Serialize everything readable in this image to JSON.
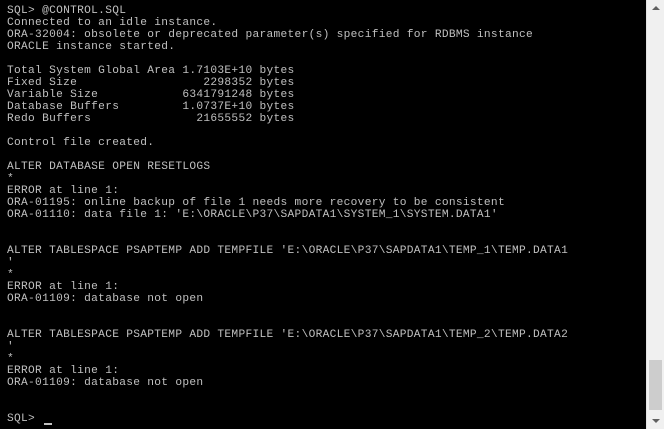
{
  "console": {
    "lines": [
      "SQL> @CONTROL.SQL",
      "Connected to an idle instance.",
      "ORA-32004: obsolete or deprecated parameter(s) specified for RDBMS instance",
      "ORACLE instance started.",
      "",
      "Total System Global Area 1.7103E+10 bytes",
      "Fixed Size                  2298352 bytes",
      "Variable Size            6341791248 bytes",
      "Database Buffers         1.0737E+10 bytes",
      "Redo Buffers               21655552 bytes",
      "",
      "Control file created.",
      "",
      "ALTER DATABASE OPEN RESETLOGS",
      "*",
      "ERROR at line 1:",
      "ORA-01195: online backup of file 1 needs more recovery to be consistent",
      "ORA-01110: data file 1: 'E:\\ORACLE\\P37\\SAPDATA1\\SYSTEM_1\\SYSTEM.DATA1'",
      "",
      "",
      "ALTER TABLESPACE PSAPTEMP ADD TEMPFILE 'E:\\ORACLE\\P37\\SAPDATA1\\TEMP_1\\TEMP.DATA1",
      "'",
      "*",
      "ERROR at line 1:",
      "ORA-01109: database not open",
      "",
      "",
      "ALTER TABLESPACE PSAPTEMP ADD TEMPFILE 'E:\\ORACLE\\P37\\SAPDATA1\\TEMP_2\\TEMP.DATA2",
      "'",
      "*",
      "ERROR at line 1:",
      "ORA-01109: database not open",
      "",
      "",
      "SQL> "
    ]
  },
  "colors": {
    "background": "#000000",
    "text": "#c0c0c0",
    "scrollbar": "#f0f0f0",
    "scrollbar_thumb": "#cdcdcd"
  },
  "icons": {
    "scroll_up": "chevron-up-icon",
    "scroll_down": "chevron-down-icon"
  }
}
